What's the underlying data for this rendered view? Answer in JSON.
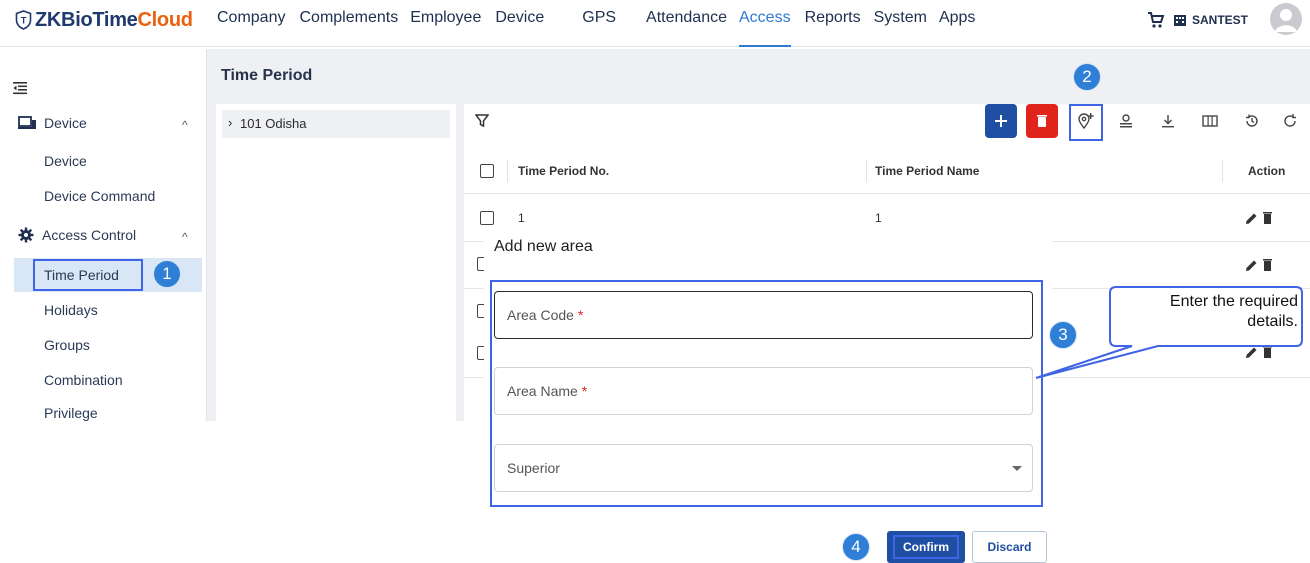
{
  "brand": {
    "part1": "ZKBioTime",
    "part2": "Cloud",
    "color1": "#1f3a6e",
    "color2": "#e8620f"
  },
  "nav": {
    "items": [
      "Company",
      "Complements",
      "Employee",
      "Device",
      "GPS",
      "Attendance",
      "Access",
      "Reports",
      "System",
      "Apps"
    ],
    "active": "Access"
  },
  "user": {
    "company": "SANTEST"
  },
  "sidebar": {
    "device_group": "Device",
    "device_items": [
      "Device",
      "Device Command"
    ],
    "access_group": "Access Control",
    "access_items": [
      "Time Period",
      "Holidays",
      "Groups",
      "Combination",
      "Privilege"
    ],
    "active_item": "Time Period"
  },
  "page": {
    "title": "Time Period"
  },
  "tree": {
    "node": "101 Odisha"
  },
  "table": {
    "headers": {
      "no": "Time Period No.",
      "name": "Time Period Name",
      "action": "Action"
    },
    "rows": [
      {
        "no": "1",
        "name": "1"
      }
    ]
  },
  "dialog": {
    "title": "Add new area",
    "fields": {
      "code_label": "Area Code",
      "name_label": "Area Name",
      "superior_label": "Superior",
      "required_mark": "*"
    },
    "confirm": "Confirm",
    "discard": "Discard"
  },
  "tutorial": {
    "steps": [
      "1",
      "2",
      "3",
      "4"
    ],
    "callout": "Enter the required details.",
    "marker_color": "#3f64e6",
    "badge_color": "#2f7fd6"
  },
  "colors": {
    "accent": "#2f79d3",
    "primary_button": "#1f4fa3",
    "delete_button": "#e0241b",
    "active_row": "#d9e6f6"
  }
}
